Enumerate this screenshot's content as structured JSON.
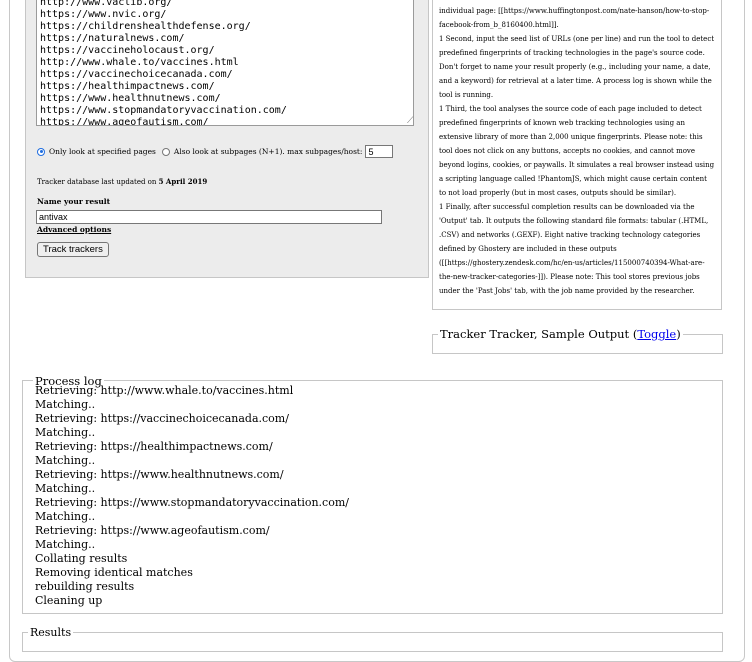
{
  "url_list": [
    "http://www.vaclib.org/",
    "https://www.nvic.org/",
    "https://childrenshealthdefense.org/",
    "https://naturalnews.com/",
    "https://vaccineholocaust.org/",
    "http://www.whale.to/vaccines.html",
    "https://vaccinechoicecanada.com/",
    "https://healthimpactnews.com/",
    "https://www.healthnutnews.com/",
    "https://www.stopmandatoryvaccination.com/",
    "https://www.ageofautism.com/"
  ],
  "scope_options": {
    "only_specified_label": "Only look at specified pages",
    "subpages_label": "Also look at subpages (N+1). max subpages/host:",
    "max_subpages_value": "5",
    "selected": "only_specified"
  },
  "database": {
    "prefix": "Tracker database last updated on",
    "date": "5 April 2019"
  },
  "result_name": {
    "label": "Name your result",
    "value": "antivax"
  },
  "advanced_options_label": "Advanced options",
  "track_button_label": "Track trackers",
  "help_paragraphs": [
    "individual page: [[https://www.huffingtonpost.com/nate-hanson/how-to-stop-facebook-from_b_8160400.html]].",
    "1 Second, input the seed list of URLs (one per line) and run the tool to detect predefined fingerprints of tracking technologies in the page's source code. Don't forget to name your result properly (e.g., including your name, a date, and a keyword) for retrieval at a later time. A process log is shown while the tool is running.",
    "1 Third, the tool analyses the source code of each page included to detect predefined fingerprints of known web tracking technologies using an extensive library of more than 2,000 unique fingerprints. Please note: this tool does not click on any buttons, accepts no cookies, and cannot move beyond logins, cookies, or paywalls. It simulates a real browser instead using a scripting language called !PhantomJS, which might cause certain content to not load properly (but in most cases, outputs should be similar).",
    "1 Finally, after successful completion results can be downloaded via the 'Output' tab. It outputs the following standard file formats: tabular (.HTML, .CSV) and networks (.GEXF). Eight native tracking technology categories defined by Ghostery are included in these outputs ([[https://ghostery.zendesk.com/hc/en-us/articles/115000740394-What-are-the-new-tracker-categories-]]). Please note: This tool stores previous jobs under the 'Past Jobs' tab, with the job name provided by the researcher."
  ],
  "sample_output": {
    "title": "Tracker Tracker, Sample Output (",
    "toggle_label": "Toggle",
    "close": ")"
  },
  "process_log": {
    "title": "Process log",
    "lines": [
      "Retrieving: http://www.whale.to/vaccines.html",
      "Matching..",
      "Retrieving: https://vaccinechoicecanada.com/",
      "Matching..",
      "Retrieving: https://healthimpactnews.com/",
      "Matching..",
      "Retrieving: https://www.healthnutnews.com/",
      "Matching..",
      "Retrieving: https://www.stopmandatoryvaccination.com/",
      "Matching..",
      "Retrieving: https://www.ageofautism.com/",
      "Matching..",
      "Collating results",
      "Removing identical matches",
      "rebuilding results",
      "Cleaning up"
    ]
  },
  "results": {
    "title": "Results"
  },
  "colors": {
    "panel_bg": "#ececec",
    "link": "#0000ee",
    "radio_accent": "#1f6de0"
  }
}
